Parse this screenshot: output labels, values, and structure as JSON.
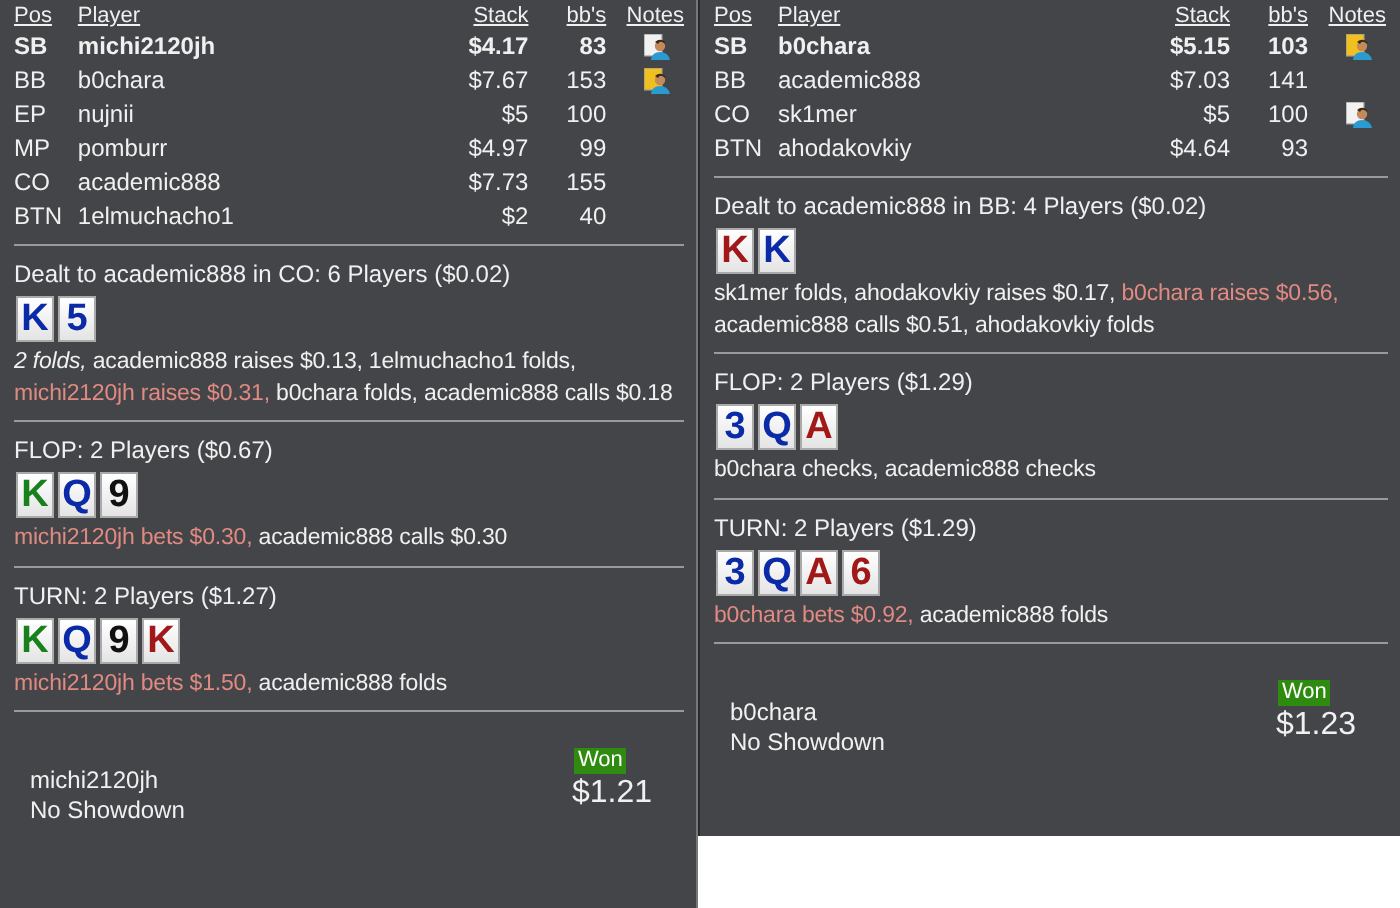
{
  "hands": [
    {
      "columns": [
        "Pos",
        "Player",
        "Stack",
        "bb's",
        "Notes"
      ],
      "players": [
        {
          "pos": "SB",
          "name": "michi2120jh",
          "stack": "$4.17",
          "bbs": "83",
          "emphasized": true,
          "note": {
            "flagged": false
          }
        },
        {
          "pos": "BB",
          "name": "b0chara",
          "stack": "$7.67",
          "bbs": "153",
          "emphasized": false,
          "note": {
            "flagged": true
          }
        },
        {
          "pos": "EP",
          "name": "nujnii",
          "stack": "$5",
          "bbs": "100",
          "emphasized": false
        },
        {
          "pos": "MP",
          "name": "pomburr",
          "stack": "$4.97",
          "bbs": "99",
          "emphasized": false
        },
        {
          "pos": "CO",
          "name": "academic888",
          "stack": "$7.73",
          "bbs": "155",
          "emphasized": false
        },
        {
          "pos": "BTN",
          "name": "1elmuchacho1",
          "stack": "$2",
          "bbs": "40",
          "emphasized": false
        }
      ],
      "streets": [
        {
          "title": "Dealt to academic888 in CO: 6 Players ($0.02)",
          "cards": [
            {
              "rank": "K",
              "color": "#0a2aa8"
            },
            {
              "rank": "5",
              "color": "#0a2aa8"
            }
          ],
          "actions": [
            {
              "text": "2 folds,",
              "kind": "passive"
            },
            {
              "text": "academic888 raises $0.13, 1elmuchacho1 folds,",
              "kind": "plain"
            },
            {
              "text": "michi2120jh raises $0.31,",
              "kind": "aggressor"
            },
            {
              "text": "b0chara folds, academic888 calls $0.18",
              "kind": "plain"
            }
          ]
        },
        {
          "title": "FLOP: 2 Players ($0.67)",
          "cards": [
            {
              "rank": "K",
              "color": "#18801c"
            },
            {
              "rank": "Q",
              "color": "#0a2aa8"
            },
            {
              "rank": "9",
              "color": "#111111"
            }
          ],
          "actions": [
            {
              "text": "michi2120jh bets $0.30,",
              "kind": "aggressor"
            },
            {
              "text": "academic888 calls $0.30",
              "kind": "plain"
            }
          ]
        },
        {
          "title": "TURN: 2 Players ($1.27)",
          "cards": [
            {
              "rank": "K",
              "color": "#18801c"
            },
            {
              "rank": "Q",
              "color": "#0a2aa8"
            },
            {
              "rank": "9",
              "color": "#111111"
            },
            {
              "rank": "K",
              "color": "#a01818"
            }
          ],
          "actions": [
            {
              "text": "michi2120jh bets $1.50,",
              "kind": "aggressor"
            },
            {
              "text": "academic888 folds",
              "kind": "plain"
            }
          ]
        }
      ],
      "result": {
        "winner": "michi2120jh",
        "outcome": "No Showdown",
        "badge": "Won",
        "amount": "$1.21"
      }
    },
    {
      "columns": [
        "Pos",
        "Player",
        "Stack",
        "bb's",
        "Notes"
      ],
      "players": [
        {
          "pos": "SB",
          "name": "b0chara",
          "stack": "$5.15",
          "bbs": "103",
          "emphasized": true,
          "note": {
            "flagged": true
          }
        },
        {
          "pos": "BB",
          "name": "academic888",
          "stack": "$7.03",
          "bbs": "141",
          "emphasized": false
        },
        {
          "pos": "CO",
          "name": "sk1mer",
          "stack": "$5",
          "bbs": "100",
          "emphasized": false,
          "note": {
            "flagged": false
          }
        },
        {
          "pos": "BTN",
          "name": "ahodakovkiy",
          "stack": "$4.64",
          "bbs": "93",
          "emphasized": false
        }
      ],
      "streets": [
        {
          "title": "Dealt to academic888 in BB: 4 Players ($0.02)",
          "cards": [
            {
              "rank": "K",
              "color": "#a01818"
            },
            {
              "rank": "K",
              "color": "#0a2aa8"
            }
          ],
          "actions": [
            {
              "text": "sk1mer folds, ahodakovkiy raises $0.17,",
              "kind": "plain"
            },
            {
              "text": "b0chara raises $0.56,",
              "kind": "aggressor"
            },
            {
              "text": "academic888 calls $0.51, ahodakovkiy folds",
              "kind": "plain"
            }
          ]
        },
        {
          "title": "FLOP: 2 Players ($1.29)",
          "cards": [
            {
              "rank": "3",
              "color": "#0a2aa8"
            },
            {
              "rank": "Q",
              "color": "#0a2aa8"
            },
            {
              "rank": "A",
              "color": "#a01818"
            }
          ],
          "actions": [
            {
              "text": "b0chara checks, academic888 checks",
              "kind": "plain"
            }
          ]
        },
        {
          "title": "TURN: 2 Players ($1.29)",
          "cards": [
            {
              "rank": "3",
              "color": "#0a2aa8"
            },
            {
              "rank": "Q",
              "color": "#0a2aa8"
            },
            {
              "rank": "A",
              "color": "#a01818"
            },
            {
              "rank": "6",
              "color": "#a01818"
            }
          ],
          "actions": [
            {
              "text": "b0chara bets $0.92,",
              "kind": "aggressor"
            },
            {
              "text": "academic888 folds",
              "kind": "plain"
            }
          ]
        }
      ],
      "result": {
        "winner": "b0chara",
        "outcome": "No Showdown",
        "badge": "Won",
        "amount": "$1.23"
      }
    }
  ]
}
